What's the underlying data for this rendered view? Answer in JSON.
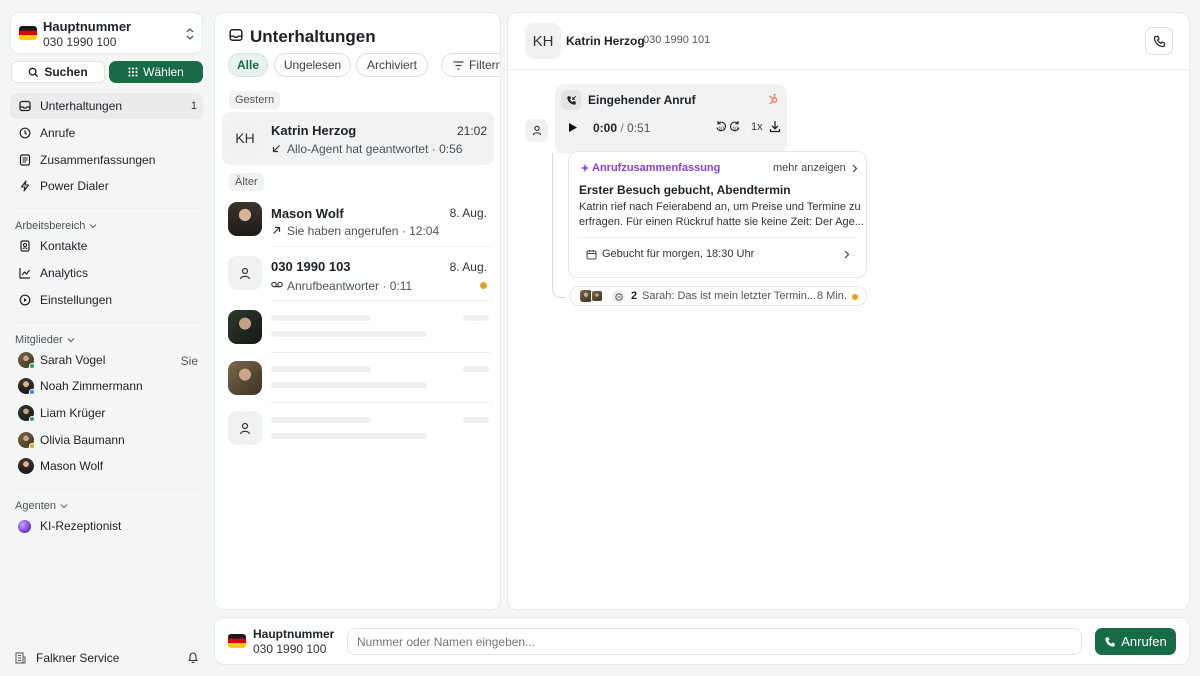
{
  "sidebar": {
    "number_title": "Hauptnummer",
    "number_value": "030 1990 100",
    "search_label": "Suchen",
    "dial_label": "Wählen",
    "nav": [
      {
        "label": "Unterhaltungen",
        "count": "1",
        "icon": "inbox-icon"
      },
      {
        "label": "Anrufe",
        "icon": "clock-icon"
      },
      {
        "label": "Zusammenfassungen",
        "icon": "document-icon"
      },
      {
        "label": "Power Dialer",
        "icon": "lightning-icon"
      }
    ],
    "workspace_label": "Arbeitsbereich",
    "workspace": [
      {
        "label": "Kontakte",
        "icon": "contacts-icon"
      },
      {
        "label": "Analytics",
        "icon": "chart-icon"
      },
      {
        "label": "Einstellungen",
        "icon": "settings-icon"
      }
    ],
    "members_label": "Mitglieder",
    "members": [
      {
        "name": "Sarah Vogel",
        "tag": "Sie",
        "status_color": "#22a35a"
      },
      {
        "name": "Noah Zimmermann",
        "tag": "",
        "status_color": "#3b82f6"
      },
      {
        "name": "Liam Krüger",
        "tag": "",
        "status_color": "#22a35a"
      },
      {
        "name": "Olivia Baumann",
        "tag": "",
        "status_color": "#e0a02a"
      },
      {
        "name": "Mason Wolf",
        "tag": "",
        "status_color": "#9aa0a6"
      }
    ],
    "agents_label": "Agenten",
    "agents": [
      {
        "name": "KI-Rezeptionist"
      }
    ],
    "company": "Falkner Service"
  },
  "conversations": {
    "title": "Unterhaltungen",
    "filters": [
      "Alle",
      "Ungelesen",
      "Archiviert"
    ],
    "filter_button": "Filtern",
    "group_yesterday": "Gestern",
    "group_older": "Älter",
    "items": [
      {
        "initials": "KH",
        "name": "Katrin Herzog",
        "time": "21:02",
        "sub": "Allo-Agent hat geantwortet · 0:56"
      },
      {
        "name": "Mason Wolf",
        "time": "8. Aug.",
        "sub": "Sie haben angerufen · 12:04"
      },
      {
        "name": "030 1990 103",
        "time": "8. Aug.",
        "sub": "Anrufbeantworter · 0:11"
      }
    ]
  },
  "detail": {
    "initials": "KH",
    "name": "Katrin Herzog",
    "number": "030 1990 101",
    "call_title": "Eingehender Anruf",
    "time_current": "0:00",
    "time_total": "0:51",
    "time_sep": " / ",
    "speed": "1x",
    "summary_label": "Anrufzusammenfassung",
    "more_label": "mehr anzeigen",
    "summary_title": "Erster Besuch gebucht, Abendtermin",
    "summary_text_1": "Katrin rief nach Feierabend an, um Preise und Termine zu",
    "summary_text_2": "erfragen. Für einen Rückruf hatte sie keine Zeit: Der Age...",
    "booking": "Gebucht für morgen, 18:30 Uhr",
    "thread_count": "2",
    "thread_text": "Sarah: Das ist mein letzter Termin...",
    "thread_time": "8 Min."
  },
  "dialer": {
    "number_title": "Hauptnummer",
    "number_value": "030 1990 100",
    "input_placeholder": "Nummer oder Namen eingeben...",
    "call_label": "Anrufen"
  }
}
